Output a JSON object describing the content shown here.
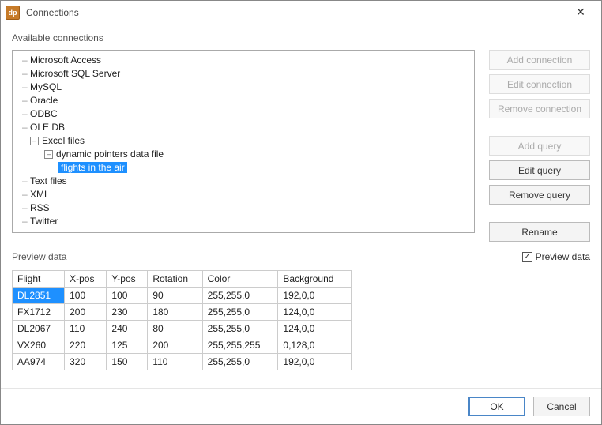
{
  "window": {
    "app_icon_text": "dp",
    "title": "Connections"
  },
  "labels": {
    "available": "Available connections",
    "preview": "Preview data",
    "preview_check": "Preview data"
  },
  "tree": {
    "items": [
      "Microsoft Access",
      "Microsoft SQL Server",
      "MySQL",
      "Oracle",
      "ODBC",
      "OLE DB"
    ],
    "excel_label": "Excel files",
    "excel_child_label": "dynamic pointers data file",
    "excel_grandchild_label": "flights in the air",
    "rest": [
      "Text files",
      "XML",
      "RSS",
      "Twitter"
    ]
  },
  "buttons": {
    "add_conn": "Add connection",
    "edit_conn": "Edit connection",
    "remove_conn": "Remove connection",
    "add_query": "Add query",
    "edit_query": "Edit query",
    "remove_query": "Remove query",
    "rename": "Rename",
    "ok": "OK",
    "cancel": "Cancel"
  },
  "preview_checked": true,
  "table": {
    "headers": [
      "Flight",
      "X-pos",
      "Y-pos",
      "Rotation",
      "Color",
      "Background"
    ],
    "rows": [
      [
        "DL2851",
        "100",
        "100",
        "90",
        "255,255,0",
        "192,0,0"
      ],
      [
        "FX1712",
        "200",
        "230",
        "180",
        "255,255,0",
        "124,0,0"
      ],
      [
        "DL2067",
        "110",
        "240",
        "80",
        "255,255,0",
        "124,0,0"
      ],
      [
        "VX260",
        "220",
        "125",
        "200",
        "255,255,255",
        "0,128,0"
      ],
      [
        "AA974",
        "320",
        "150",
        "110",
        "255,255,0",
        "192,0,0"
      ]
    ],
    "selected_row": 0,
    "selected_col": 0
  }
}
